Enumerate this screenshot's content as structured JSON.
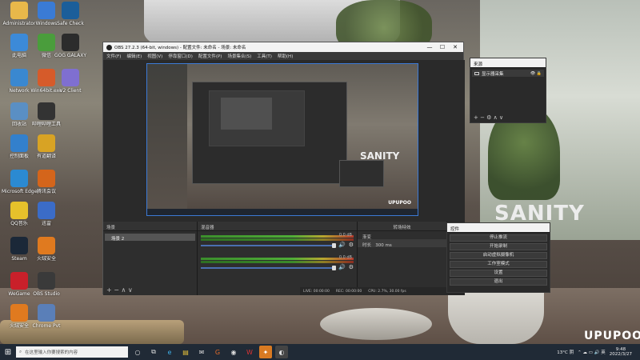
{
  "desktop": {
    "icons": [
      {
        "label": "Administrator",
        "color": "#e8b84a"
      },
      {
        "label": "Windows",
        "color": "#3a7bd5"
      },
      {
        "label": "Safe Check",
        "color": "#1b5e9a"
      },
      {
        "label": "此电脑",
        "color": "#3c8ad8"
      },
      {
        "label": "微信",
        "color": "#4a9d3c"
      },
      {
        "label": "GOG GALAXY",
        "color": "#2c2c2c"
      },
      {
        "label": "Network",
        "color": "#3a88d0"
      },
      {
        "label": "Win64bit.exe",
        "color": "#d65b2a"
      },
      {
        "label": "V2 Client",
        "color": "#7f6fd0"
      },
      {
        "label": "回收站",
        "color": "#5a8fc4"
      },
      {
        "label": "哔哩哔哩工具",
        "color": "#333333"
      },
      {
        "label": "控制面板",
        "color": "#3380cc"
      },
      {
        "label": "有道翻译",
        "color": "#d8a324"
      },
      {
        "label": "Microsoft Edge",
        "color": "#2b8ad2"
      },
      {
        "label": "腾讯会议",
        "color": "#d4651b"
      },
      {
        "label": "QQ音乐",
        "color": "#e6c12b"
      },
      {
        "label": "迅雷",
        "color": "#3b6cc7"
      },
      {
        "label": "Steam",
        "color": "#1b2838"
      },
      {
        "label": "火绒安全",
        "color": "#e07a1f"
      },
      {
        "label": "WeGame",
        "color": "#c9202a"
      },
      {
        "label": "OBS Studio",
        "color": "#3a3a3a"
      },
      {
        "label": "火绒安全",
        "color": "#e07a1f"
      },
      {
        "label": "Chrome Pvt",
        "color": "#5a7fb8"
      }
    ],
    "sanity_text": "SANITY",
    "watermark": "UPUPOO"
  },
  "obs": {
    "title": "OBS 27.2.3 (64-bit, windows) - 配置文件: 未命名 - 场景: 未命名",
    "window_controls": [
      "—",
      "☐",
      "✕"
    ],
    "menu": [
      "文件(F)",
      "编辑(E)",
      "视图(V)",
      "停靠窗口(D)",
      "配置文件(P)",
      "场景集合(S)",
      "工具(T)",
      "帮助(H)"
    ],
    "preview": {
      "sanity_text": "SANITY",
      "watermark": "UPUPOO"
    },
    "scenes": {
      "title": "场景",
      "items": [
        "场景 2"
      ],
      "footer": "+ − ∧ ∨"
    },
    "sources": {
      "title": "来源"
    },
    "mixer": {
      "title": "混音器",
      "channels": [
        {
          "name": "",
          "db": "0.0 dB"
        },
        {
          "name": "",
          "db": "0.0 dB"
        }
      ]
    },
    "transitions": {
      "title": "转场特效",
      "type": "渐变",
      "duration_label": "时长",
      "duration_value": "300 ms"
    },
    "status": {
      "live": "LIVE: 00:00:00",
      "rec": "REC: 00:00:00",
      "cpu": "CPU: 2.7%, 30.00 fps"
    }
  },
  "src_dock": {
    "title": "来源",
    "items": [
      {
        "label": "显示器采集"
      }
    ],
    "footer": "+ − ⚙ ∧ ∨"
  },
  "controls": {
    "title": "控件",
    "buttons": [
      "停止推流",
      "开始录制",
      "启动虚拟摄像机",
      "工作室模式",
      "设置",
      "退出"
    ]
  },
  "taskbar": {
    "search_placeholder": "在这里输入你要搜索的内容",
    "apps": [
      "○",
      "⧉",
      "e",
      "▤",
      "✉",
      "G",
      "◉",
      "W",
      "✦",
      "◐"
    ],
    "weather": "13°C 阴",
    "time": "9:48",
    "date": "2022/3/27"
  }
}
